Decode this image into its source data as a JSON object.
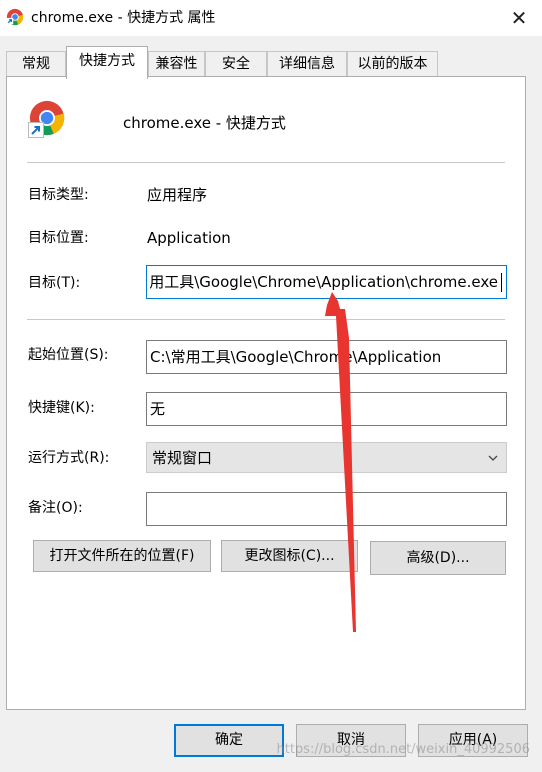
{
  "window": {
    "title": "chrome.exe - 快捷方式 属性",
    "close_glyph": "✕"
  },
  "tabs": [
    {
      "label": "常规"
    },
    {
      "label": "快捷方式",
      "active": true
    },
    {
      "label": "兼容性"
    },
    {
      "label": "安全"
    },
    {
      "label": "详细信息"
    },
    {
      "label": "以前的版本"
    }
  ],
  "shortcut": {
    "name": "chrome.exe - 快捷方式",
    "target_type_label": "目标类型:",
    "target_type_value": "应用程序",
    "target_location_label": "目标位置:",
    "target_location_value": "Application",
    "target_label": "目标(T):",
    "target_value": "用工具\\Google\\Chrome\\Application\\chrome.exe",
    "start_in_label": "起始位置(S):",
    "start_in_value": "C:\\常用工具\\Google\\Chrome\\Application",
    "hotkey_label": "快捷键(K):",
    "hotkey_value": "无",
    "run_label": "运行方式(R):",
    "run_value": "常规窗口",
    "comment_label": "备注(O):",
    "comment_value": "",
    "open_location_button": "打开文件所在的位置(F)",
    "change_icon_button": "更改图标(C)...",
    "advanced_button": "高级(D)..."
  },
  "footer": {
    "ok": "确定",
    "cancel": "取消",
    "apply": "应用(A)"
  },
  "watermark": "https://blog.csdn.net/weixin_40992506",
  "icons": [
    "chrome-icon",
    "shortcut-arrow-icon",
    "close-icon",
    "chevron-down-icon"
  ],
  "colors": {
    "accent": "#0078d7",
    "annotation_arrow": "#e8352f"
  }
}
